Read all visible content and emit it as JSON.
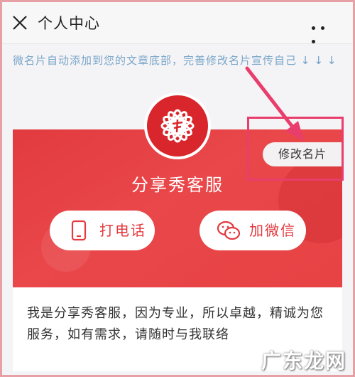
{
  "header": {
    "title": "个人中心"
  },
  "tip": {
    "text": "微名片自动添加到您的文章底部，完善修改名片宣传自己",
    "arrows": "↓↓↓"
  },
  "card": {
    "name": "分享秀客服",
    "edit_label": "修改名片",
    "call_label": "打电话",
    "wechat_label": "加微信"
  },
  "description": {
    "text": "我是分享秀客服，因为专业，所以卓越，精诚为您服务，如有需求，请随时与我联络"
  },
  "watermark": {
    "text": "广东龙网"
  },
  "colors": {
    "card_red": "#e23b3f",
    "annotation_pink": "#e93d6c",
    "tip_blue": "#7aa7c9"
  }
}
